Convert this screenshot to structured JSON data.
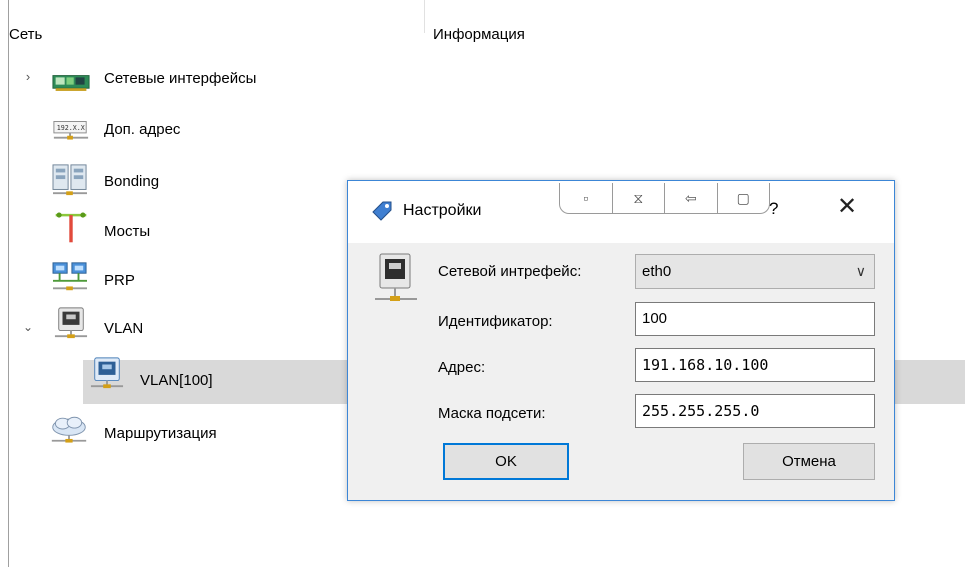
{
  "header": {
    "col_network": "Сеть",
    "col_info": "Информация"
  },
  "tree": {
    "items": [
      {
        "label": "Сетевые интерфейсы",
        "icon": "network-card-icon"
      },
      {
        "label": "Доп. адрес",
        "icon": "ip-address-icon"
      },
      {
        "label": "Bonding",
        "icon": "bonding-icon"
      },
      {
        "label": "Мосты",
        "icon": "bridge-icon"
      },
      {
        "label": "PRP",
        "icon": "prp-icon"
      },
      {
        "label": "VLAN",
        "icon": "vlan-icon"
      },
      {
        "label": "VLAN[100]",
        "icon": "vlan-icon"
      },
      {
        "label": "Маршрутизация",
        "icon": "routing-cloud-icon"
      }
    ],
    "selected": "VLAN[100]"
  },
  "dialog": {
    "title": "Настройки",
    "help": "?",
    "close": "✕",
    "labels": {
      "interface": "Сетевой интрефейс:",
      "id": "Идентификатор:",
      "address": "Адрес:",
      "mask": "Маска подсети:"
    },
    "values": {
      "interface": "eth0",
      "id": "100",
      "address": "191.168.10.100",
      "mask": "255.255.255.0"
    },
    "buttons": {
      "ok": "OK",
      "cancel": "Отмена"
    }
  },
  "colors": {
    "selection": "#d9d9d9",
    "dialog_border": "#3c86d6",
    "ok_border": "#0078d7"
  }
}
